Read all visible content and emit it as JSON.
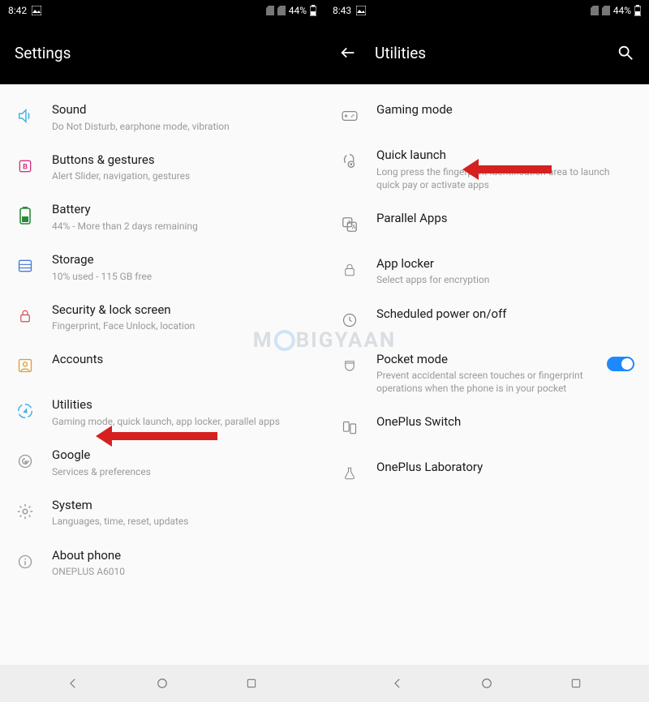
{
  "watermark": "MOBIGYAAN",
  "left": {
    "status": {
      "time": "8:42",
      "battery": "44%"
    },
    "header": {
      "title": "Settings"
    },
    "items": [
      {
        "icon": "sound",
        "title": "Sound",
        "sub": "Do Not Disturb, earphone mode, vibration"
      },
      {
        "icon": "buttons",
        "title": "Buttons & gestures",
        "sub": "Alert Slider, navigation, gestures"
      },
      {
        "icon": "battery",
        "title": "Battery",
        "sub": "44% - More than 2 days remaining"
      },
      {
        "icon": "storage",
        "title": "Storage",
        "sub": "10% used - 115 GB free"
      },
      {
        "icon": "lock",
        "title": "Security & lock screen",
        "sub": "Fingerprint, Face Unlock, location"
      },
      {
        "icon": "accounts",
        "title": "Accounts",
        "sub": ""
      },
      {
        "icon": "utilities",
        "title": "Utilities",
        "sub": "Gaming mode, quick launch, app locker, parallel apps"
      },
      {
        "icon": "google",
        "title": "Google",
        "sub": "Services & preferences"
      },
      {
        "icon": "system",
        "title": "System",
        "sub": "Languages, time, reset, updates"
      },
      {
        "icon": "about",
        "title": "About phone",
        "sub": "ONEPLUS A6010"
      }
    ]
  },
  "right": {
    "status": {
      "time": "8:43",
      "battery": "44%"
    },
    "header": {
      "title": "Utilities"
    },
    "items": [
      {
        "icon": "gaming",
        "title": "Gaming mode",
        "sub": ""
      },
      {
        "icon": "quicklaunch",
        "title": "Quick launch",
        "sub": "Long press the fingerprint identification area to launch quick pay or activate apps"
      },
      {
        "icon": "parallel",
        "title": "Parallel Apps",
        "sub": ""
      },
      {
        "icon": "applock",
        "title": "App locker",
        "sub": "Select apps for encryption"
      },
      {
        "icon": "schedule",
        "title": "Scheduled power on/off",
        "sub": ""
      },
      {
        "icon": "pocket",
        "title": "Pocket mode",
        "sub": "Prevent accidental screen touches or fingerprint operations when the phone is in your pocket",
        "toggle": true
      },
      {
        "icon": "switch",
        "title": "OnePlus Switch",
        "sub": ""
      },
      {
        "icon": "lab",
        "title": "OnePlus Laboratory",
        "sub": ""
      }
    ]
  }
}
